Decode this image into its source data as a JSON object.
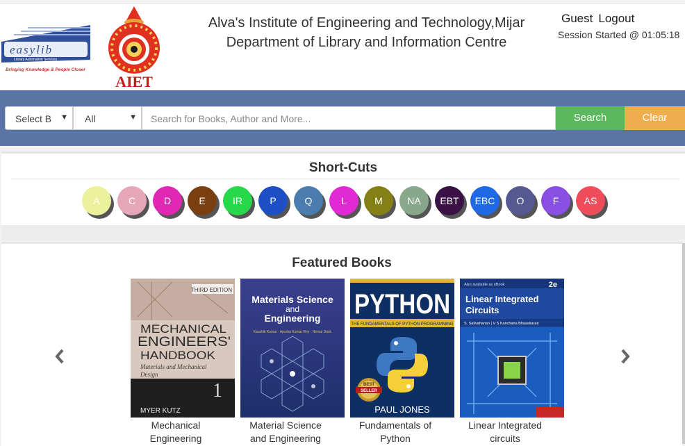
{
  "header": {
    "logo_easylib": {
      "word": "easylib",
      "sub": "Library Automation Services",
      "tagline": "Bringing Knowledge & People Closer"
    },
    "logo_aiet": "AIET",
    "title_line1": "Alva's Institute of Engineering and Technology,Mijar",
    "title_line2": "Department of Library and Information Centre",
    "user": "Guest",
    "logout": "Logout",
    "session": "Session Started @ 01:05:18"
  },
  "search": {
    "select_type": "Select B",
    "select_scope": "All",
    "placeholder": "Search for Books, Author and More...",
    "search_label": "Search",
    "clear_label": "Clear"
  },
  "shortcuts": {
    "title": "Short-Cuts",
    "items": [
      {
        "label": "A",
        "color": "#ecf29c"
      },
      {
        "label": "C",
        "color": "#e6a8b8"
      },
      {
        "label": "D",
        "color": "#e028b4"
      },
      {
        "label": "E",
        "color": "#7a3f10"
      },
      {
        "label": "IR",
        "color": "#27d94a"
      },
      {
        "label": "P",
        "color": "#1f4fc6"
      },
      {
        "label": "Q",
        "color": "#4a7cad"
      },
      {
        "label": "L",
        "color": "#e02ad3"
      },
      {
        "label": "M",
        "color": "#858016"
      },
      {
        "label": "NA",
        "color": "#87a88a"
      },
      {
        "label": "EBT",
        "color": "#3a1245"
      },
      {
        "label": "EBC",
        "color": "#1f69e6"
      },
      {
        "label": "O",
        "color": "#565891"
      },
      {
        "label": "F",
        "color": "#8a4fe3"
      },
      {
        "label": "AS",
        "color": "#ef4d5b"
      }
    ]
  },
  "featured": {
    "title": "Featured Books",
    "books": [
      {
        "caption_1": "Mechanical",
        "caption_2": "Engineering",
        "cover": {
          "edition": "THIRD EDITION",
          "t1": "MECHANICAL",
          "t2": "ENGINEERS'",
          "t3": "HANDBOOK",
          "sub1": "Materials and Mechanical",
          "sub2": "Design",
          "author": "MYER KUTZ",
          "vol": "1"
        }
      },
      {
        "caption_1": "Material Science",
        "caption_2": "and Engineering",
        "cover": {
          "t1": "Materials Science",
          "t2": "and",
          "t3": "Engineering",
          "authors": "Kaushik Kumar · Apurba Kumar Roy · Nirmal Dash"
        }
      },
      {
        "caption_1": "Fundamentals of",
        "caption_2": "Python",
        "cover": {
          "t1": "PYTHON",
          "sub": "THE FUNDAMENTALS OF PYTHON PROGRAMMING",
          "badge_1": "BEST",
          "badge_2": "SELLER",
          "author": "PAUL JONES"
        }
      },
      {
        "caption_1": "Linear Integrated",
        "caption_2": "circuits",
        "cover": {
          "edition": "2e",
          "t1": "Linear Integrated",
          "t2": "Circuits",
          "authors": "S. Salivahanan | V S Kanchana Bhaaskaran",
          "top_strip": "Also available as eBook"
        }
      }
    ]
  }
}
